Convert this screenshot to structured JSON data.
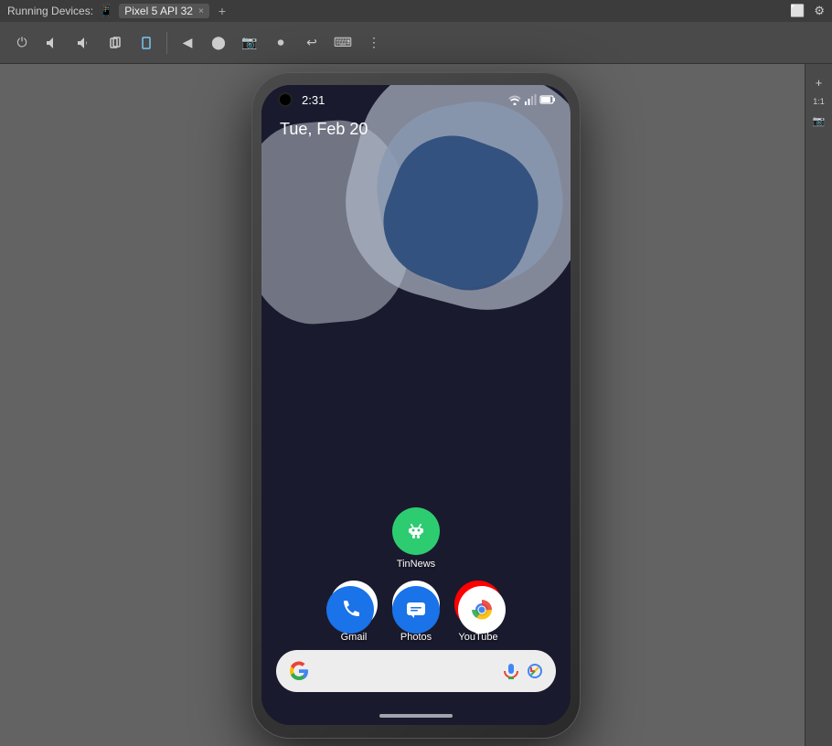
{
  "topbar": {
    "running_devices_label": "Running Devices:",
    "device_name": "Pixel 5 API 32",
    "tab_close": "×",
    "tab_add": "+"
  },
  "toolbar": {
    "buttons": [
      {
        "name": "power-icon",
        "symbol": "⏻"
      },
      {
        "name": "volume-off-icon",
        "symbol": "🔇"
      },
      {
        "name": "volume-down-icon",
        "symbol": "🔉"
      },
      {
        "name": "rotate-icon",
        "symbol": "⟳"
      },
      {
        "name": "screenshot-icon",
        "symbol": "📱"
      },
      {
        "name": "camera-shutter-icon",
        "symbol": "📷"
      },
      {
        "name": "record-icon",
        "symbol": "⏺"
      },
      {
        "name": "back-icon",
        "symbol": "⟵"
      },
      {
        "name": "rotate-screen-icon",
        "symbol": "↩"
      },
      {
        "name": "keyboard-icon",
        "symbol": "⌨"
      },
      {
        "name": "more-icon",
        "symbol": "⋮"
      }
    ]
  },
  "phone": {
    "status_time": "2:31",
    "date": "Tue, Feb 20",
    "apps": {
      "row1": [
        {
          "name": "TinNews",
          "icon_type": "tinnews",
          "label": "TinNews"
        }
      ],
      "row2": [
        {
          "name": "Gmail",
          "icon_type": "gmail",
          "label": "Gmail"
        },
        {
          "name": "Photos",
          "icon_type": "photos",
          "label": "Photos"
        },
        {
          "name": "YouTube",
          "icon_type": "youtube",
          "label": "YouTube"
        }
      ]
    },
    "dock": [
      {
        "name": "Phone",
        "icon_type": "phone"
      },
      {
        "name": "Messages",
        "icon_type": "messages"
      },
      {
        "name": "Chrome",
        "icon_type": "chrome"
      }
    ]
  },
  "sidebar": {
    "zoom_in_label": "+",
    "ratio_label": "1:1",
    "screenshot_label": "📷"
  }
}
